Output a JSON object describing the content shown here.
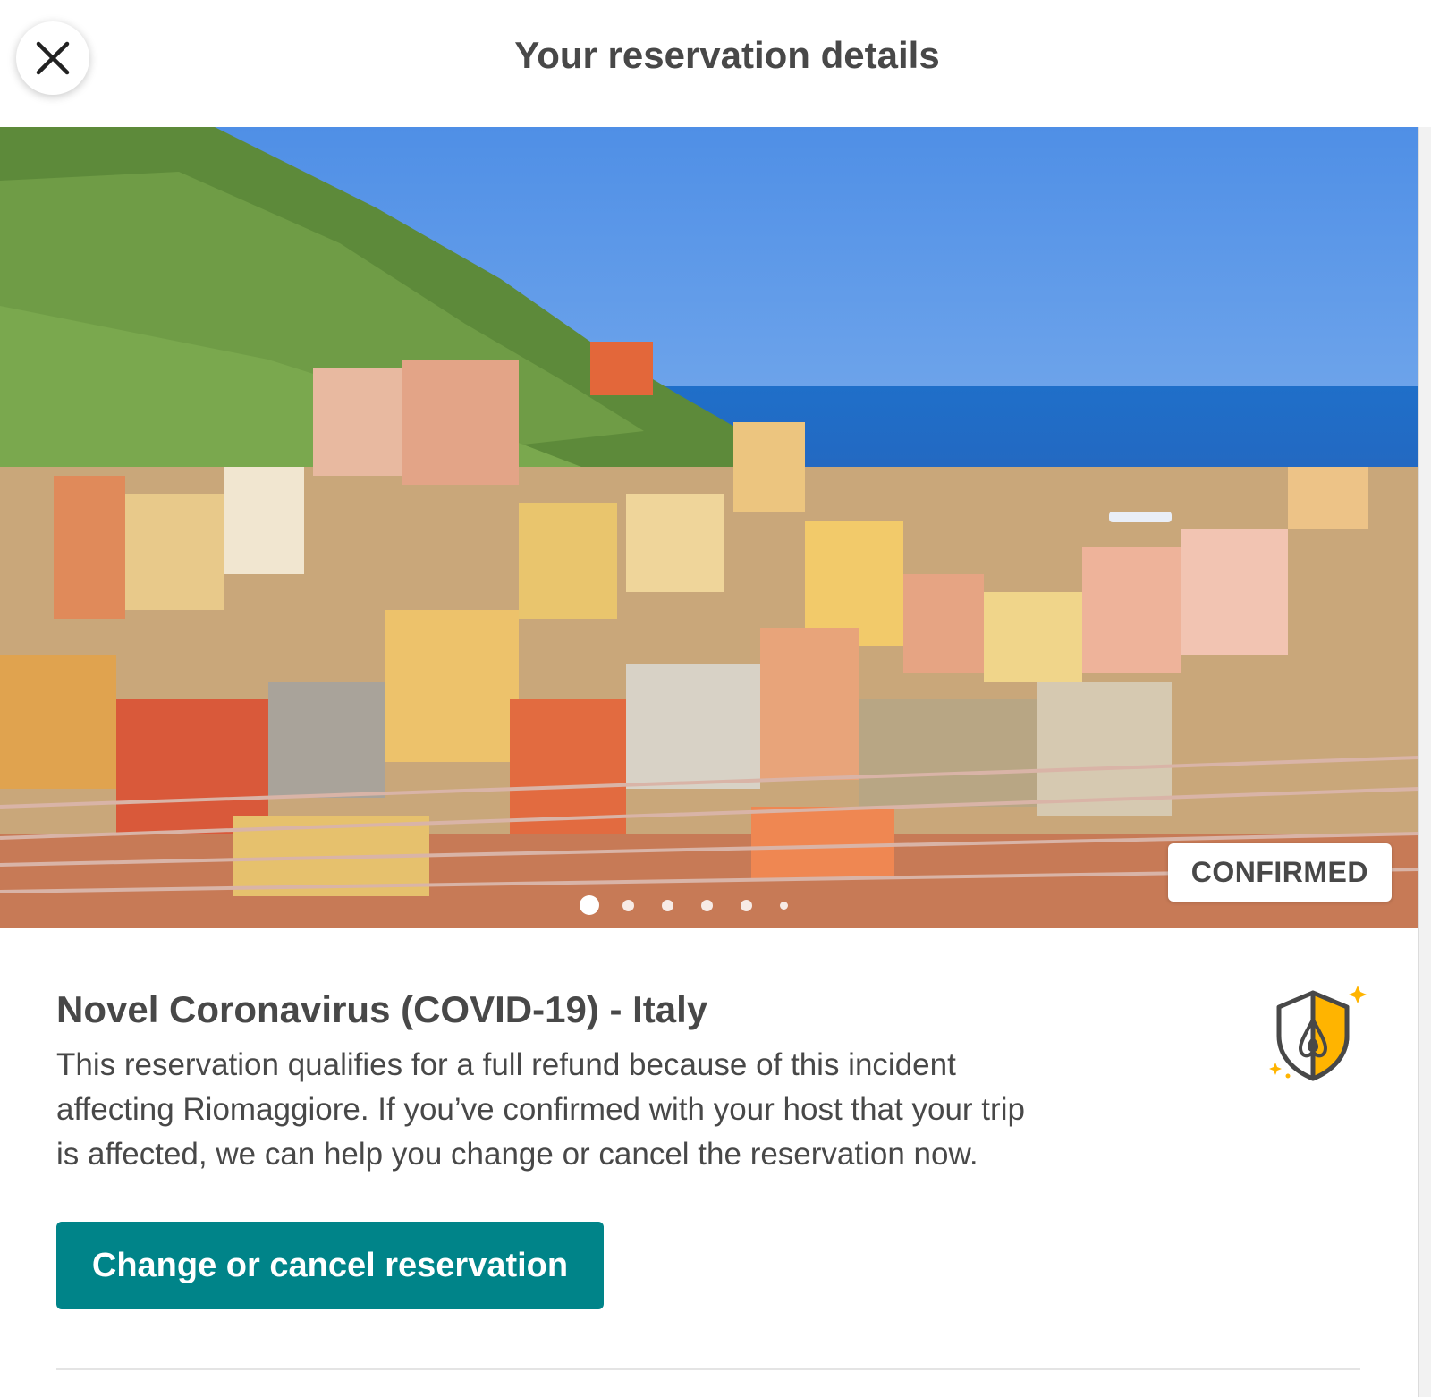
{
  "header": {
    "title": "Your reservation details",
    "close_icon": "close-icon"
  },
  "hero": {
    "image_subject": "Hillside coastal village of colorful houses above the sea",
    "status_badge": "CONFIRMED",
    "carousel": {
      "total_dots": 6,
      "active_index": 0
    }
  },
  "notice": {
    "title": "Novel Coronavirus (COVID-19) - Italy",
    "lines": [
      "This reservation qualifies for a full refund because of this incident",
      "affecting Riomaggiore. If you’ve confirmed with your host that your trip",
      "is affected, we can help you change or cancel the reservation now."
    ],
    "icon": "shield-icon",
    "cta_label": "Change or cancel reservation"
  },
  "colors": {
    "accent": "#008489",
    "text": "#484848",
    "shield_fill": "#ffb400"
  }
}
